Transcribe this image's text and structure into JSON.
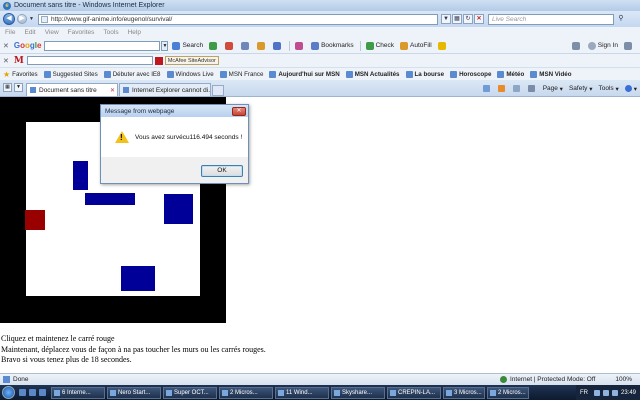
{
  "window": {
    "title": "Document sans titre - Windows Internet Explorer"
  },
  "nav": {
    "back_icon": "back-arrow-icon",
    "forward_icon": "forward-arrow-icon",
    "address": "http://www.gif-anime.info/eugenol/survival/",
    "live_search_placeholder": "Live Search"
  },
  "menu": [
    "File",
    "Edit",
    "View",
    "Favorites",
    "Tools",
    "Help"
  ],
  "google_toolbar": {
    "logo": {
      "b1": "G",
      "r1": "o",
      "y": "o",
      "b2": "g",
      "gr": "l",
      "r2": "e"
    },
    "search_label": "Search",
    "bookmarks_label": "Bookmarks",
    "check_label": "Check",
    "autofill_label": "AutoFill",
    "signin_label": "Sign In"
  },
  "mcafee": {
    "logo": "M",
    "advisor": "McAfee SiteAdvisor"
  },
  "favorites": {
    "label": "Favorites",
    "items": [
      {
        "label": "Suggested Sites",
        "bold": false
      },
      {
        "label": "Débuter avec IE8",
        "bold": false
      },
      {
        "label": "Windows Live",
        "bold": false
      },
      {
        "label": "MSN France",
        "bold": false
      },
      {
        "label": "Aujourd'hui sur MSN",
        "bold": true
      },
      {
        "label": "MSN Actualités",
        "bold": true
      },
      {
        "label": "La bourse",
        "bold": true
      },
      {
        "label": "Horoscope",
        "bold": true
      },
      {
        "label": "Météo",
        "bold": true
      },
      {
        "label": "MSN Vidéo",
        "bold": true
      }
    ]
  },
  "tabs": [
    {
      "label": "Document sans titre",
      "active": true
    },
    {
      "label": "Internet Explorer cannot di...",
      "active": false
    }
  ],
  "commands": {
    "page": "Page",
    "safety": "Safety",
    "tools": "Tools"
  },
  "game": {
    "instructions": [
      "Cliquez et maintenez le carré rouge",
      "Maintenant, déplacez vous de façon à na pas toucher les murs ou les carrés rouges.",
      "Bravo si vous tenez plus de 18 secondes."
    ],
    "colors": {
      "wall": "#000000",
      "blue": "#000099",
      "red": "#990000"
    }
  },
  "dialog": {
    "title": "Message from webpage",
    "message": "Vous avez survécu116.494 seconds !",
    "ok_label": "OK",
    "icon": "warning-icon"
  },
  "status": {
    "left": "Done",
    "zone": "Internet | Protected Mode: Off",
    "zoom": "100%"
  },
  "taskbar": {
    "tasks": [
      "6 Interne...",
      "Nero Start...",
      "Super OCT...",
      "2 Micros...",
      "11 Wind...",
      "Skyshare...",
      "CREPIN-LA...",
      "3 Micros...",
      "2 Micros..."
    ],
    "lang": "FR",
    "clock": "23:49"
  }
}
